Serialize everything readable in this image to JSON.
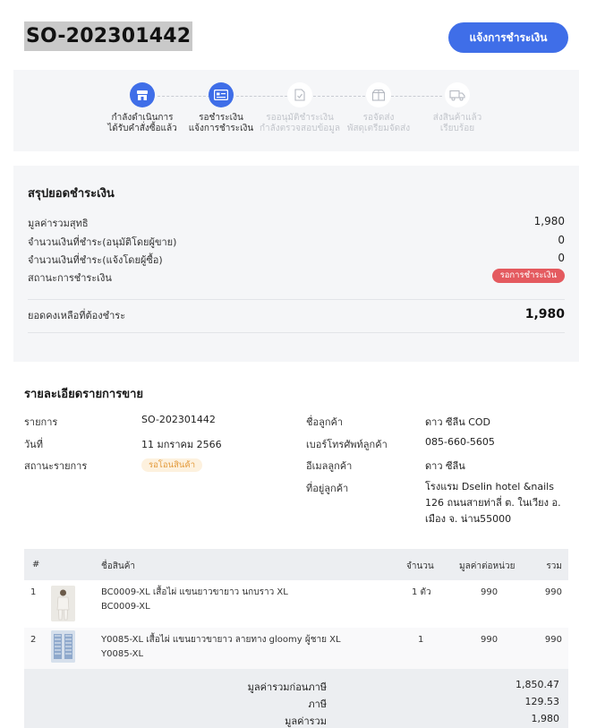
{
  "header": {
    "order_id": "SO-202301442",
    "notify_payment_label": "แจ้งการชำระเงิน"
  },
  "stepper": {
    "steps": [
      {
        "line1": "กำลังดำเนินการ",
        "line2": "ได้รับคำสั่งซื้อแล้ว",
        "icon": "store-icon",
        "state": "done"
      },
      {
        "line1": "รอชำระเงิน",
        "line2": "แจ้งการชำระเงิน",
        "icon": "payment-card-icon",
        "state": "current"
      },
      {
        "line1": "รออนุมัติชำระเงิน",
        "line2": "กำลังตรวจสอบข้อมูล",
        "icon": "document-check-icon",
        "state": "pending"
      },
      {
        "line1": "รอจัดส่ง",
        "line2": "พัสดุเตรียมจัดส่ง",
        "icon": "package-icon",
        "state": "pending"
      },
      {
        "line1": "ส่งสินค้าแล้ว",
        "line2": "เรียบร้อย",
        "icon": "truck-icon",
        "state": "pending"
      }
    ]
  },
  "summary": {
    "title": "สรุปยอดชำระเงิน",
    "rows": [
      {
        "label": "มูลค่ารวมสุทธิ",
        "value": "1,980"
      },
      {
        "label": "จำนวนเงินที่ชำระ(อนุมัติโดยผู้ขาย)",
        "value": "0"
      },
      {
        "label": "จำนวนเงินที่ชำระ(แจ้งโดยผู้ซื้อ)",
        "value": "0"
      }
    ],
    "status_label": "สถานะการชำระเงิน",
    "status_badge": "รอการชำระเงิน",
    "balance_label": "ยอดคงเหลือที่ต้องชำระ",
    "balance_value": "1,980"
  },
  "detail": {
    "title": "รายละเอียดรายการขาย",
    "order_label": "รายการ",
    "order_value": "SO-202301442",
    "date_label": "วันที่",
    "date_value": "11 มกราคม 2566",
    "status_label": "สถานะรายการ",
    "status_badge": "รอโอนสินค้า",
    "customer_label": "ชื่อลูกค้า",
    "customer_value": "ดาว ซีลีน COD",
    "phone_label": "เบอร์โทรศัพท์ลูกค้า",
    "phone_value": "085-660-5605",
    "email_label": "อีเมลลูกค้า",
    "email_value": "ดาว ซีลีน",
    "address_label": "ที่อยู่ลูกค้า",
    "address_value": "โรงแรม Dselin hotel &nails 126 ถนนสายท่าลี่ ต. ในเวียง อ. เมือง จ. น่าน55000"
  },
  "table": {
    "headers": {
      "index": "#",
      "name": "ชื่อสินค้า",
      "qty": "จำนวน",
      "unit_price": "มูลค่าต่อหน่วย",
      "total": "รวม"
    },
    "rows": [
      {
        "index": "1",
        "name": "BC0009-XL เสื้อไผ่ แขนยาวขายาว นกบราว XL",
        "sku": "BC0009-XL",
        "qty": "1 ตัว",
        "unit_price": "990",
        "total": "990"
      },
      {
        "index": "2",
        "name": "Y0085-XL เสื้อไผ่ แขนยาวขายาว ลายทาง gloomy ผู้ชาย XL",
        "sku": "Y0085-XL",
        "qty": "1",
        "unit_price": "990",
        "total": "990"
      }
    ],
    "totals": {
      "subtotal_label": "มูลค่ารวมก่อนภาษี",
      "subtotal_value": "1,850.47",
      "tax_label": "ภาษี",
      "tax_value": "129.53",
      "total_label": "มูลค่ารวม",
      "total_value": "1,980"
    }
  },
  "colors": {
    "primary": "#3f6ee8",
    "badge_red": "#e45a5f",
    "badge_yellow_bg": "#fdf1de",
    "badge_yellow_text": "#e39a3c"
  }
}
